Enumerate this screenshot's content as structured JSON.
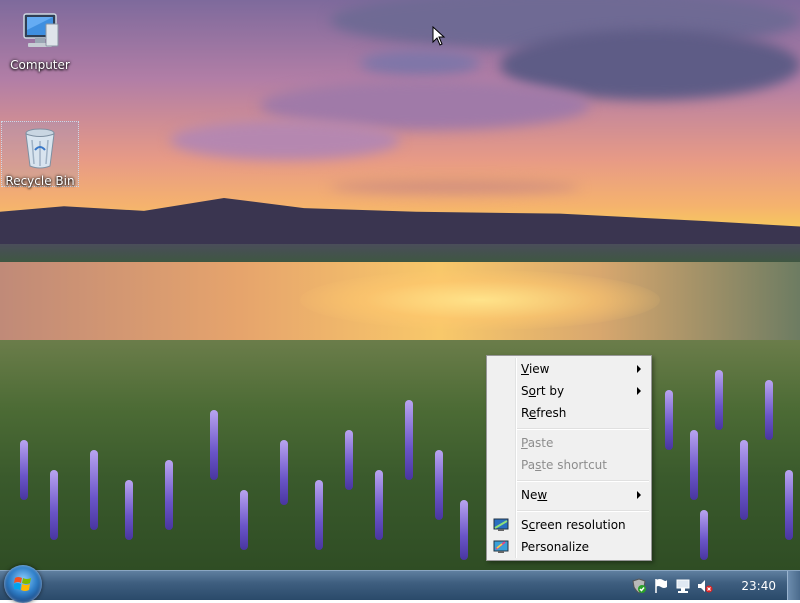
{
  "desktop": {
    "icons": [
      {
        "label": "Computer",
        "icon": "computer-icon"
      },
      {
        "label": "Recycle Bin",
        "icon": "recycle-bin-icon",
        "selected": true
      }
    ]
  },
  "context_menu": {
    "items": [
      {
        "label": "View",
        "accel": "V",
        "submenu": true,
        "enabled": true
      },
      {
        "label": "Sort by",
        "accel": "o",
        "submenu": true,
        "enabled": true
      },
      {
        "label": "Refresh",
        "accel": "e",
        "enabled": true
      },
      {
        "label": "Paste",
        "accel": "P",
        "enabled": false
      },
      {
        "label": "Paste shortcut",
        "accel": "s",
        "enabled": false
      },
      {
        "label": "New",
        "accel": "w",
        "submenu": true,
        "enabled": true
      },
      {
        "label": "Screen resolution",
        "accel": "c",
        "icon": "screen-resolution-icon",
        "enabled": true
      },
      {
        "label": "Personalize",
        "accel": "R",
        "icon": "personalize-icon",
        "enabled": true
      }
    ]
  },
  "taskbar": {
    "start_icon": "windows-orb-icon",
    "tray_icons": [
      "security-shield-icon",
      "action-center-flag-icon",
      "network-icon",
      "volume-muted-icon"
    ],
    "clock": "23:40"
  },
  "colors": {
    "menu_bg": "#f0f0f0",
    "menu_disabled": "#8d8d8d",
    "taskbar": "#3f5f80"
  }
}
